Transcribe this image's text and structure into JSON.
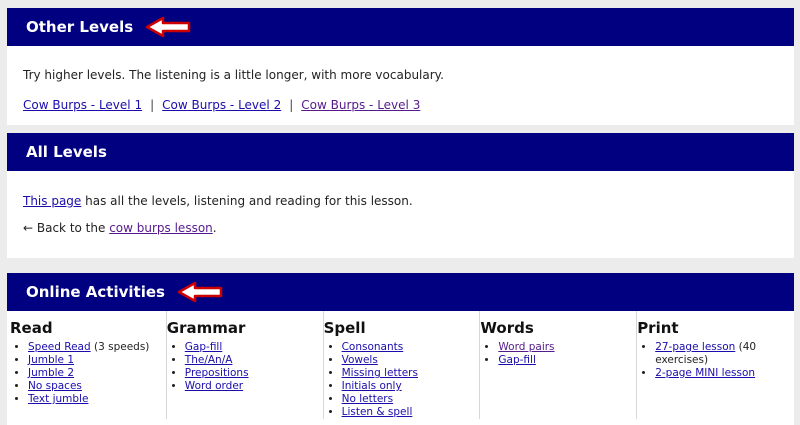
{
  "other_levels": {
    "title": "Other Levels",
    "text": "Try higher levels. The listening is a little longer, with more vocabulary.",
    "links": [
      "Cow Burps - Level 1",
      "Cow Burps - Level 2",
      "Cow Burps - Level 3"
    ],
    "separator": "|"
  },
  "all_levels": {
    "title": "All Levels",
    "this_page_link": "This page",
    "text": " has all the levels, listening and reading for this lesson.",
    "back_prefix": "← Back to the ",
    "back_link": "cow burps lesson",
    "back_suffix": "."
  },
  "online_activities": {
    "title": "Online Activities",
    "columns": [
      {
        "heading": "Read",
        "items": [
          {
            "link": "Speed Read",
            "note": " (3 speeds)"
          },
          {
            "link": "Jumble 1",
            "note": ""
          },
          {
            "link": "Jumble 2",
            "note": ""
          },
          {
            "link": "No spaces",
            "note": ""
          },
          {
            "link": "Text jumble",
            "note": ""
          }
        ]
      },
      {
        "heading": "Grammar",
        "items": [
          {
            "link": "Gap-fill",
            "note": ""
          },
          {
            "link": "The/An/A",
            "note": ""
          },
          {
            "link": "Prepositions",
            "note": ""
          },
          {
            "link": "Word order",
            "note": ""
          }
        ]
      },
      {
        "heading": "Spell",
        "items": [
          {
            "link": "Consonants",
            "note": ""
          },
          {
            "link": "Vowels",
            "note": ""
          },
          {
            "link": "Missing letters",
            "note": ""
          },
          {
            "link": "Initials only",
            "note": ""
          },
          {
            "link": "No letters",
            "note": ""
          },
          {
            "link": "Listen & spell",
            "note": ""
          }
        ]
      },
      {
        "heading": "Words",
        "items": [
          {
            "link": "Word pairs",
            "note": ""
          },
          {
            "link": "Gap-fill",
            "note": ""
          }
        ]
      },
      {
        "heading": "Print",
        "items": [
          {
            "link": "27-page lesson",
            "note": " (40 exercises)"
          },
          {
            "link": "2-page MINI lesson",
            "note": ""
          }
        ]
      }
    ]
  },
  "colors": {
    "header_bar": "#000080",
    "arrow": "#cc0000",
    "link": "#1a0dab",
    "visited_link": "#551a8b"
  },
  "icons": {
    "header_arrow": "left-arrow-icon"
  }
}
